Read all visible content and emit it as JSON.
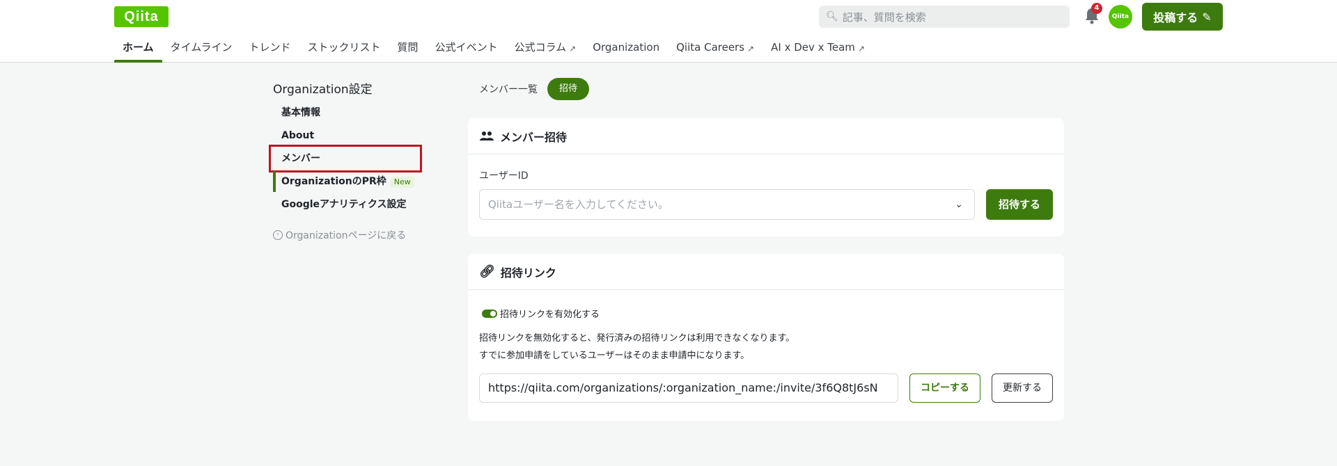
{
  "header": {
    "logo_text": "Qiita",
    "search_placeholder": "記事、質問を検索",
    "notification_count": "4",
    "avatar_text": "Qiita",
    "post_button": "投稿する"
  },
  "nav": {
    "items": [
      {
        "label": "ホーム",
        "active": true
      },
      {
        "label": "タイムライン"
      },
      {
        "label": "トレンド"
      },
      {
        "label": "ストックリスト"
      },
      {
        "label": "質問"
      },
      {
        "label": "公式イベント"
      },
      {
        "label": "公式コラム",
        "external": true
      },
      {
        "label": "Organization"
      },
      {
        "label": "Qiita Careers",
        "external": true
      },
      {
        "label": "AI x Dev x Team",
        "external": true
      }
    ]
  },
  "sidebar": {
    "title": "Organization設定",
    "items": [
      {
        "label": "基本情報"
      },
      {
        "label": "About"
      },
      {
        "label": "メンバー"
      },
      {
        "label": "OrganizationのPR枠",
        "badge": "New"
      },
      {
        "label": "Googleアナリティクス設定"
      }
    ],
    "back_link": "Organizationページに戻る"
  },
  "tabs": {
    "members_list": "メンバー一覧",
    "invite": "招待"
  },
  "invite_card": {
    "title": "メンバー招待",
    "user_id_label": "ユーザーID",
    "user_id_placeholder": "Qiitaユーザー名を入力してください。",
    "invite_button": "招待する"
  },
  "link_card": {
    "title": "招待リンク",
    "toggle_label": "招待リンクを有効化する",
    "toggle_on": true,
    "desc_line1": "招待リンクを無効化すると、発行済みの招待リンクは利用できなくなります。",
    "desc_line2": "すでに参加申請をしているユーザーはそのまま申請中になります。",
    "url": "https://qiita.com/organizations/:organization_name:/invite/3f6Q8tJ6sN",
    "copy_button": "コピーする",
    "update_button": "更新する"
  },
  "colors": {
    "brand_green": "#55c500",
    "primary_green": "#3d7b0f",
    "highlight_red": "#c0121f"
  }
}
